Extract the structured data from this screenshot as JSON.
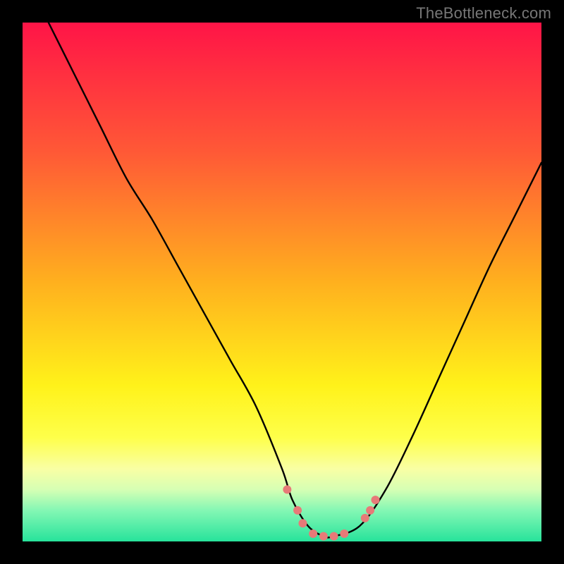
{
  "attribution": "TheBottleneck.com",
  "chart_data": {
    "type": "line",
    "title": "",
    "xlabel": "",
    "ylabel": "",
    "xlim": [
      0,
      100
    ],
    "ylim": [
      0,
      100
    ],
    "grid": false,
    "legend": false,
    "background": {
      "type": "gradient-vertical",
      "stops": [
        {
          "pos": 0.0,
          "color": "#ff1447"
        },
        {
          "pos": 0.25,
          "color": "#ff5936"
        },
        {
          "pos": 0.5,
          "color": "#ffb01e"
        },
        {
          "pos": 0.7,
          "color": "#fff21a"
        },
        {
          "pos": 0.8,
          "color": "#feff4a"
        },
        {
          "pos": 0.86,
          "color": "#f9ffa4"
        },
        {
          "pos": 0.9,
          "color": "#d6ffb4"
        },
        {
          "pos": 0.94,
          "color": "#84f7b4"
        },
        {
          "pos": 1.0,
          "color": "#27e39b"
        }
      ]
    },
    "series": [
      {
        "name": "bottleneck-curve",
        "color": "#000000",
        "x": [
          5,
          10,
          15,
          20,
          25,
          30,
          35,
          40,
          45,
          50,
          52,
          55,
          58,
          60,
          65,
          70,
          75,
          80,
          85,
          90,
          95,
          100
        ],
        "y": [
          100,
          90,
          80,
          70,
          62,
          53,
          44,
          35,
          26,
          14,
          8,
          3,
          1,
          1,
          3,
          10,
          20,
          31,
          42,
          53,
          63,
          73
        ]
      }
    ],
    "markers": {
      "name": "highlight-points",
      "color": "#e77a78",
      "radius_px": 6,
      "points": [
        {
          "x": 51.0,
          "y": 10.0
        },
        {
          "x": 53.0,
          "y": 6.0
        },
        {
          "x": 54.0,
          "y": 3.5
        },
        {
          "x": 56.0,
          "y": 1.5
        },
        {
          "x": 58.0,
          "y": 1.0
        },
        {
          "x": 60.0,
          "y": 1.0
        },
        {
          "x": 62.0,
          "y": 1.5
        },
        {
          "x": 66.0,
          "y": 4.5
        },
        {
          "x": 67.0,
          "y": 6.0
        },
        {
          "x": 68.0,
          "y": 8.0
        }
      ]
    }
  }
}
